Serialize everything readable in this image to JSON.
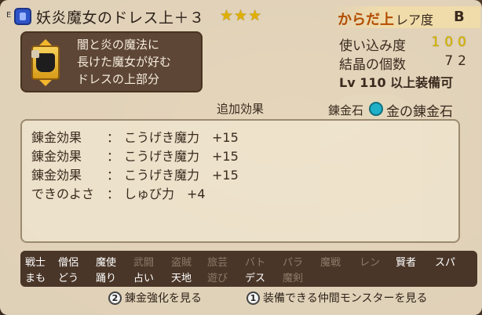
{
  "header": {
    "equip_mark": "E",
    "slot_icon": "armor-slot-icon",
    "item_name": "妖炎魔女のドレス上＋３",
    "stars": "★★★",
    "slot_type": "からだ上",
    "rarity_label": "レア度",
    "rarity_value": "B"
  },
  "description": {
    "portrait_icon": "dress-top-icon",
    "lines": [
      "闇と炎の魔法に",
      "長けた魔女が好む",
      "ドレスの上部分"
    ]
  },
  "stats": {
    "usage_label": "使い込み度",
    "usage_value": "100",
    "crystal_label": "結晶の個数",
    "crystal_value": "72",
    "level_text": "Lv 110 以上装備可"
  },
  "effects": {
    "title": "追加効果",
    "stone_label": "錬金石",
    "stone_icon": "alchemy-stone-icon",
    "stone_name": "金の錬金石",
    "rows": [
      {
        "key": "錬金効果",
        "colon": "：",
        "value": "こうげき魔力　+15"
      },
      {
        "key": "錬金効果",
        "colon": "：",
        "value": "こうげき魔力　+15"
      },
      {
        "key": "錬金効果",
        "colon": "：",
        "value": "こうげき魔力　+15"
      },
      {
        "key": "できのよさ",
        "colon": "：",
        "value": "しゅび力　+4"
      }
    ]
  },
  "jobs": {
    "row1": [
      {
        "label": "戦士",
        "on": true
      },
      {
        "label": "僧侶",
        "on": true
      },
      {
        "label": "魔使",
        "on": true
      },
      {
        "label": "武闘",
        "on": false
      },
      {
        "label": "盗賊",
        "on": false
      },
      {
        "label": "旅芸",
        "on": false
      },
      {
        "label": "バト",
        "on": false
      },
      {
        "label": "パラ",
        "on": false
      },
      {
        "label": "魔戦",
        "on": false
      },
      {
        "label": "レン",
        "on": false
      },
      {
        "label": "賢者",
        "on": true
      },
      {
        "label": "スパ",
        "on": true
      }
    ],
    "row2": [
      {
        "label": "まも",
        "on": true
      },
      {
        "label": "どう",
        "on": true
      },
      {
        "label": "踊り",
        "on": true
      },
      {
        "label": "占い",
        "on": true
      },
      {
        "label": "天地",
        "on": true
      },
      {
        "label": "遊び",
        "on": false
      },
      {
        "label": "デス",
        "on": true
      },
      {
        "label": "魔剣",
        "on": false
      }
    ]
  },
  "footer": {
    "hint1_btn": "2",
    "hint1_text": "錬金強化を見る",
    "hint2_btn": "1",
    "hint2_text": "装備できる仲間モンスターを見る"
  }
}
